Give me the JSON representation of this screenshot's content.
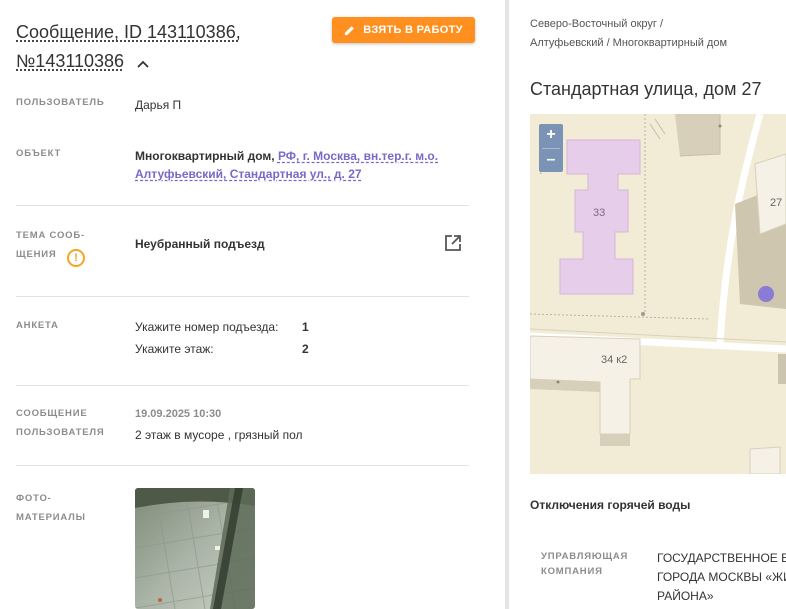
{
  "message": {
    "title_line1": "Сообщение, ID 143110386,",
    "title_line2": "№143110386",
    "take_button": "ВЗЯТЬ В РАБОТУ"
  },
  "fields": {
    "user_label": "ПОЛЬЗОВАТЕЛЬ",
    "user_value": "Дарья П",
    "object_label": "ОБЪЕКТ",
    "object_type": "Многоквартирный дом,",
    "object_link_line1": "РФ, г. Москва, вн.тер.г. м.о.",
    "object_link_line2": "Алтуфьевский, Стандартная ул., д. 27",
    "topic_label_line1": "ТЕМА СООБ-",
    "topic_label_line2": "ЩЕНИЯ",
    "topic_value": "Неубранный подъезд",
    "survey_label": "АНКЕТА",
    "survey": [
      {
        "question": "Укажите номер подъезда:",
        "answer": "1"
      },
      {
        "question": "Укажите этаж:",
        "answer": "2"
      }
    ],
    "user_msg_label_line1": "СООБЩЕНИЕ",
    "user_msg_label_line2": "ПОЛЬЗОВАТЕЛЯ",
    "user_msg_date": "19.09.2025 10:30",
    "user_msg_text": "2 этаж в мусоре , грязный пол",
    "photo_label_line1": "ФОТО-",
    "photo_label_line2": "МАТЕРИАЛЫ"
  },
  "right": {
    "breadcrumb_line1": "Северо-Восточный округ /",
    "breadcrumb_line2": "Алтуфьевский / Многоквартирный дом",
    "address": "Стандартная улица, дом 27",
    "map": {
      "zoom_in": "+",
      "zoom_out": "–",
      "building_33": "33",
      "building_27": "27",
      "building_34k2": "34 к2"
    },
    "section_title": "Отключения горячей воды",
    "mc_label_line1": "УПРАВЛЯЮЩАЯ",
    "mc_label_line2": "КОМПАНИЯ",
    "mc_value_line1": "ГОСУДАРСТВЕННОЕ БЮ",
    "mc_value_line2": "ГОРОДА МОСКВЫ «ЖИ",
    "mc_value_line3": "РАЙОНА»"
  },
  "colors": {
    "accent": "#ff8f1f",
    "link": "#7b68c8",
    "warning": "#f5a623",
    "map_marker": "#8a7bd6",
    "building_highlight": "#e6cdea"
  }
}
